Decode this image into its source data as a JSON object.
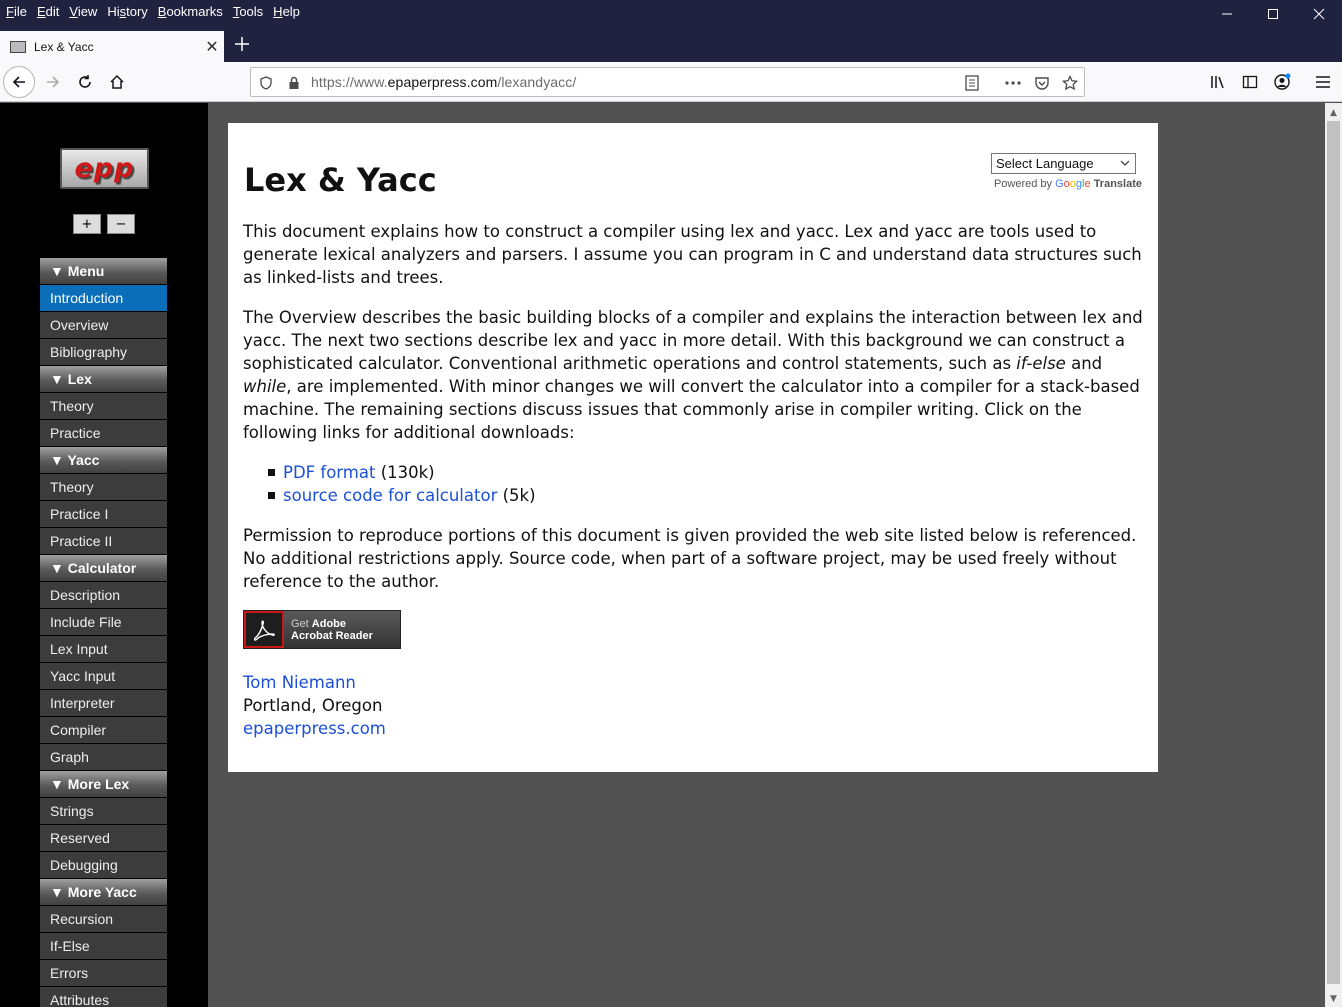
{
  "browser": {
    "menu": [
      "File",
      "Edit",
      "View",
      "History",
      "Bookmarks",
      "Tools",
      "Help"
    ],
    "menu_access_keys": [
      "F",
      "E",
      "V",
      "s",
      "B",
      "T",
      "H"
    ],
    "tab_title": "Lex & Yacc",
    "url_prefix": "https://www.",
    "url_host": "epaperpress.com",
    "url_path": "/lexandyacc/"
  },
  "sidebar": {
    "logo_text": "epp",
    "increase_label": "+",
    "decrease_label": "−",
    "menu": [
      {
        "type": "section",
        "label": "▼ Menu"
      },
      {
        "type": "link",
        "label": "Introduction",
        "active": true
      },
      {
        "type": "link",
        "label": "Overview"
      },
      {
        "type": "link",
        "label": "Bibliography"
      },
      {
        "type": "section",
        "label": "▼ Lex"
      },
      {
        "type": "link",
        "label": "Theory"
      },
      {
        "type": "link",
        "label": "Practice"
      },
      {
        "type": "section",
        "label": "▼ Yacc"
      },
      {
        "type": "link",
        "label": "Theory"
      },
      {
        "type": "link",
        "label": "Practice I"
      },
      {
        "type": "link",
        "label": "Practice II"
      },
      {
        "type": "section",
        "label": "▼ Calculator"
      },
      {
        "type": "link",
        "label": "Description"
      },
      {
        "type": "link",
        "label": "Include File"
      },
      {
        "type": "link",
        "label": "Lex Input"
      },
      {
        "type": "link",
        "label": "Yacc Input"
      },
      {
        "type": "link",
        "label": "Interpreter"
      },
      {
        "type": "link",
        "label": "Compiler"
      },
      {
        "type": "link",
        "label": "Graph"
      },
      {
        "type": "section",
        "label": "▼ More Lex"
      },
      {
        "type": "link",
        "label": "Strings"
      },
      {
        "type": "link",
        "label": "Reserved"
      },
      {
        "type": "link",
        "label": "Debugging"
      },
      {
        "type": "section",
        "label": "▼ More Yacc"
      },
      {
        "type": "link",
        "label": "Recursion"
      },
      {
        "type": "link",
        "label": "If-Else"
      },
      {
        "type": "link",
        "label": "Errors"
      },
      {
        "type": "link",
        "label": "Attributes"
      }
    ]
  },
  "content": {
    "title": "Lex & Yacc",
    "translate": {
      "select_value": "Select Language",
      "powered_by": "Powered by ",
      "google_letters": [
        "G",
        "o",
        "o",
        "g",
        "l",
        "e"
      ],
      "translate_word": "Translate"
    },
    "para1": "This document explains how to construct a compiler using lex and yacc. Lex and yacc are tools used to generate lexical analyzers and parsers. I assume you can program in C and understand data structures such as linked-lists and trees.",
    "para2_a": "The Overview describes the basic building blocks of a compiler and explains the interaction between lex and yacc. The next two sections describe lex and yacc in more detail. With this background we can construct a sophisticated calculator. Conventional arithmetic operations and control statements, such as ",
    "para2_em1": "if-else",
    "para2_b": " and ",
    "para2_em2": "while",
    "para2_c": ", are implemented. With minor changes we will convert the calculator into a compiler for a stack-based machine. The remaining sections discuss issues that commonly arise in compiler writing. Click on the following links for additional downloads:",
    "downloads": [
      {
        "link": "PDF format",
        "size": " (130k)"
      },
      {
        "link": "source code for calculator",
        "size": " (5k)"
      }
    ],
    "para3": "Permission to reproduce portions of this document is given provided the web site listed below is referenced. No additional restrictions apply. Source code, when part of a software project, may be used freely without reference to the author.",
    "acrobat_get": "Get ",
    "acrobat_line1": "Adobe",
    "acrobat_line2": "Acrobat Reader",
    "author_name": "Tom Niemann",
    "author_location": "Portland, Oregon",
    "author_site": "epaperpress.com"
  },
  "colors": {
    "chrome": "#202340",
    "sidebar_active": "#0b6eb8",
    "link": "#1a4fd6",
    "page_bg": "#525252"
  }
}
